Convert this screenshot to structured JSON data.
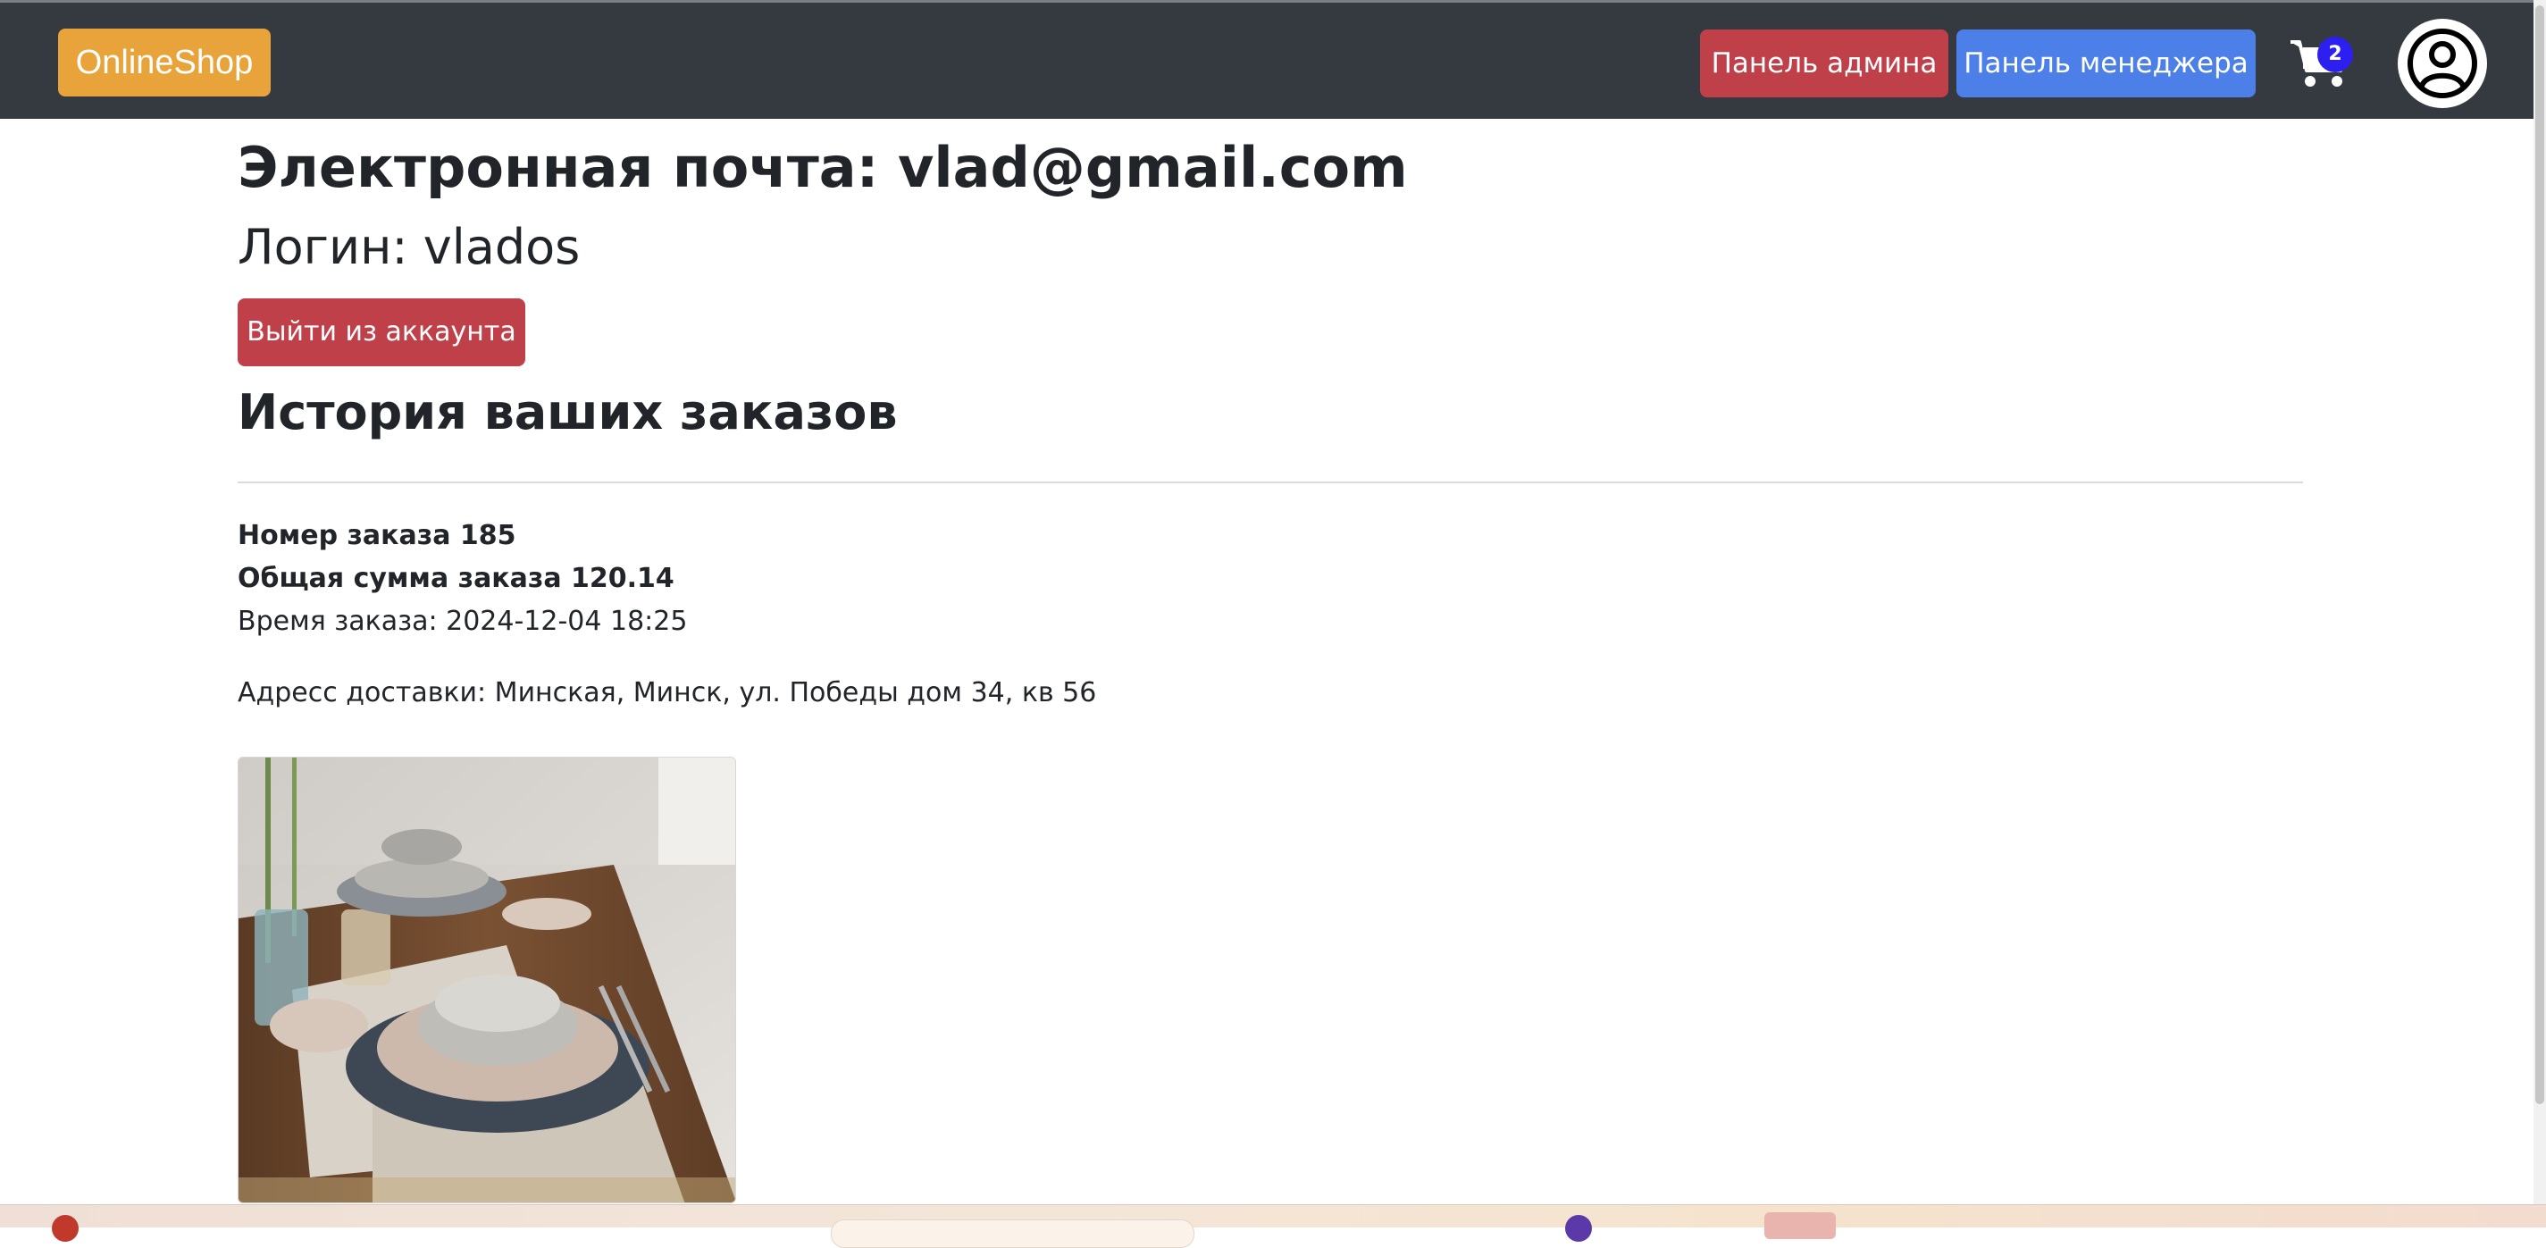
{
  "navbar": {
    "brand": "OnlineShop",
    "admin_panel_label": "Панель админа",
    "manager_panel_label": "Панель менеджера",
    "cart_count": "2",
    "icons": {
      "cart": "shopping-cart-icon",
      "profile": "user-circle-icon"
    },
    "colors": {
      "background": "#343a40",
      "brand": "#e8a33a",
      "admin": "#c0404a",
      "manager": "#4d7fe8",
      "badge": "#2c1ff0"
    }
  },
  "profile": {
    "email": "Электронная почта: vlad@gmail.com",
    "login": "Логин: vlados",
    "logout_label": "Выйти из аккаунта"
  },
  "orders": {
    "title": "История ваших заказов",
    "items": [
      {
        "number": "Номер заказа 185",
        "total": "Общая сумма заказа 120.14",
        "time": "Время заказа: 2024-12-04 18:25",
        "address": "Адресс доставки: Минская, Минск, ул. Победы дом 34, кв 56",
        "image": "tableware-product-photo"
      }
    ]
  }
}
